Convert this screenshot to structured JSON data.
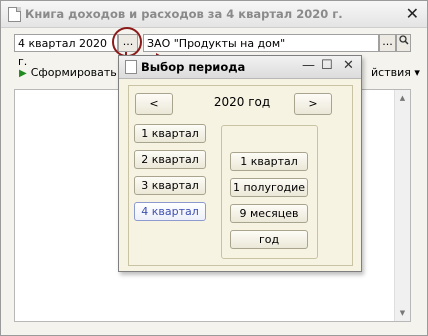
{
  "window": {
    "title": "Книга доходов и расходов за 4 квартал 2020 г.",
    "close": "✕"
  },
  "form": {
    "period_value": "4 квартал 2020 г.",
    "period_button": "...",
    "org_value": "ЗАО \"Продукты на дом\"",
    "org_button": "...",
    "org_search": "🔍"
  },
  "toolbar": {
    "generate_label": "Сформировать",
    "actions_label": "йствия ▾"
  },
  "dialog": {
    "title": "Выбор периода",
    "minimize": "—",
    "maximize": "☐",
    "close": "✕",
    "prev": "<",
    "next": ">",
    "year": "2020 год",
    "quarters": [
      "1 квартал",
      "2 квартал",
      "3 квартал",
      "4 квартал"
    ],
    "selected_quarter": "4 квартал",
    "periods": [
      "1 квартал",
      "1 полугодие",
      "9 месяцев",
      "год"
    ]
  },
  "colors": {
    "highlight": "#8b1a1a",
    "selected_text": "#3c4fb0"
  }
}
